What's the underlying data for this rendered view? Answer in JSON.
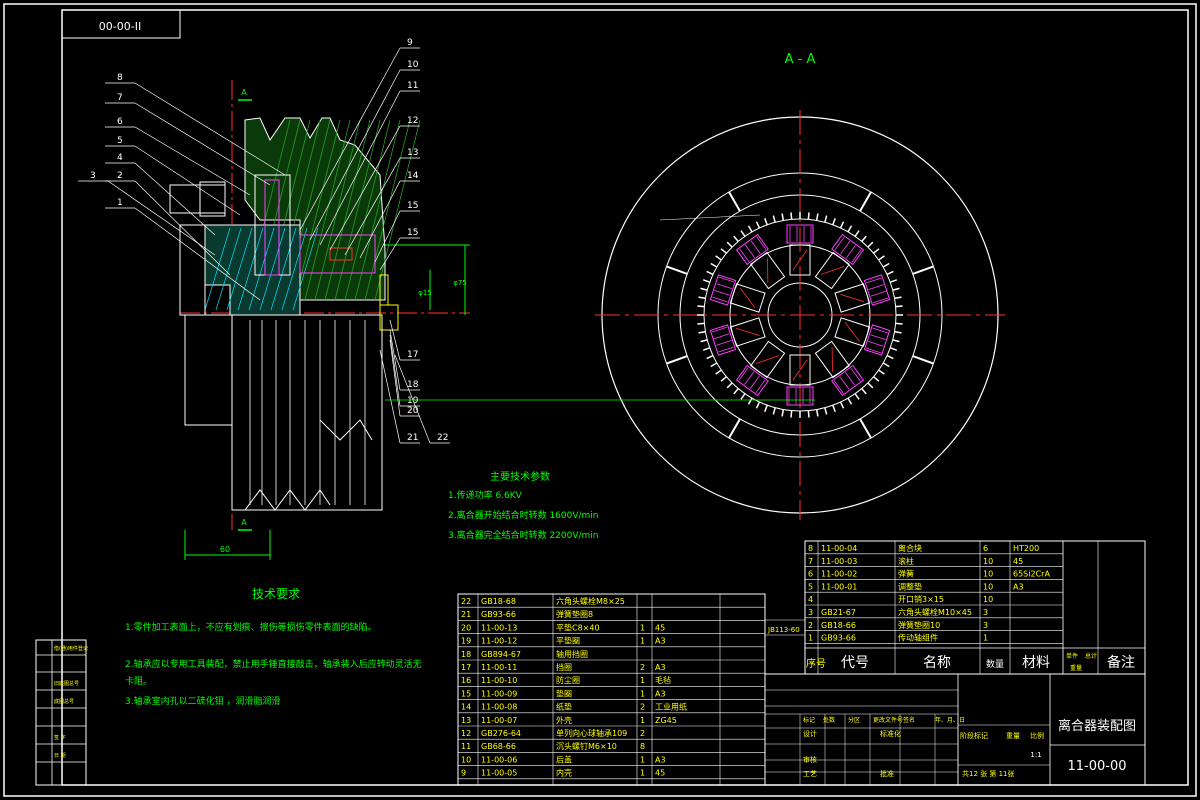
{
  "drawing_code_box": "00-00-II",
  "section_label": "A - A",
  "section_marker": "A",
  "dim_width": "60",
  "dim_diameter": "φ75",
  "dim_small": "φ15",
  "callouts": [
    "1",
    "2",
    "3",
    "4",
    "5",
    "6",
    "7",
    "8",
    "9",
    "10",
    "11",
    "12",
    "13",
    "14",
    "15",
    "15",
    "17",
    "18",
    "19",
    "20",
    "21",
    "22"
  ],
  "params": {
    "title": "主要技术参数",
    "items": [
      "1.传递功率          6.6KV",
      "2.离合器开始结合时转数   1600V/min",
      "3.离合器完全结合时转数   2200V/min"
    ]
  },
  "tech_req": {
    "title": "技术要求",
    "items": [
      "1.零件加工表面上，不应有划痕、擦伤等损伤零件表面的缺陷。",
      "2.轴承应以专用工具装配，禁止用手锤直接敲击，轴承装入后应转动灵活无",
      "卡阻。",
      "3.轴承室内孔以二硫化钼 ，润滑脂润滑"
    ]
  },
  "left_strip": [
    "借(通)用件登记",
    "旧底图总号",
    "底图总号",
    "签 字",
    "日 期"
  ],
  "bom_lower": [
    [
      "22",
      "GB18-68",
      "六角头螺栓M8×25",
      "",
      "",
      ""
    ],
    [
      "21",
      "GB93-66",
      "弹簧垫圈8",
      "",
      "",
      ""
    ],
    [
      "20",
      "11-00-13",
      "平垫C8×40",
      "1",
      "45",
      ""
    ],
    [
      "19",
      "11-00-12",
      "平垫圈",
      "1",
      "A3",
      ""
    ],
    [
      "18",
      "GB894-67",
      "轴用挡圈",
      "",
      "",
      ""
    ],
    [
      "17",
      "11-00-11",
      "挡圈",
      "2",
      "A3",
      ""
    ],
    [
      "16",
      "11-00-10",
      "防尘圈",
      "1",
      "毛毡",
      ""
    ],
    [
      "15",
      "11-00-09",
      "垫圈",
      "1",
      "A3",
      ""
    ],
    [
      "14",
      "11-00-08",
      "纸垫",
      "2",
      "工业用纸",
      ""
    ],
    [
      "13",
      "11-00-07",
      "外壳",
      "1",
      "ZG45",
      ""
    ],
    [
      "12",
      "GB276-64",
      "单列向心球轴承109",
      "2",
      "",
      ""
    ],
    [
      "11",
      "GB68-66",
      "沉头螺钉M6×10",
      "8",
      "",
      ""
    ],
    [
      "10",
      "11-00-06",
      "后盖",
      "1",
      "A3",
      ""
    ],
    [
      "9",
      "11-00-05",
      "内壳",
      "1",
      "45",
      ""
    ]
  ],
  "bom_upper": [
    [
      "8",
      "11-00-04",
      "离合块",
      "6",
      "HT200",
      ""
    ],
    [
      "7",
      "11-00-03",
      "滚柱",
      "10",
      "45",
      ""
    ],
    [
      "6",
      "11-00-02",
      "弹簧",
      "10",
      "65Si2CrA",
      ""
    ],
    [
      "5",
      "11-00-01",
      "调整垫",
      "10",
      "A3",
      ""
    ],
    [
      "4",
      "",
      "开口销3×15",
      "10",
      "",
      ""
    ],
    [
      "3",
      "GB21-67",
      "六角头螺栓M10×45",
      "3",
      "",
      ""
    ],
    [
      "2",
      "GB18-66",
      "弹簧垫圈10",
      "3",
      "",
      ""
    ],
    [
      "1",
      "GB93-66",
      "传动轴组件",
      "1",
      "",
      ""
    ]
  ],
  "bom_standard": "JB113-60",
  "bom_header": {
    "seq": "序号",
    "code": "代号",
    "name": "名称",
    "qty": "数量",
    "material": "材料",
    "unit_wt": "单件",
    "total_wt": "总计",
    "weight": "重量",
    "remark": "备注"
  },
  "title_block": {
    "drawing_name": "离合器装配图",
    "drawing_no": "11-00-00",
    "scale": "1:1",
    "sheets": "共12 张  第 11张",
    "rows": [
      "标记",
      "处数",
      "分区",
      "更改文件号",
      "签名",
      "年、月、日"
    ],
    "labels": [
      "设计",
      "标准化",
      "审核",
      "工艺",
      "批准",
      "阶段标记",
      "重量",
      "比例"
    ]
  }
}
